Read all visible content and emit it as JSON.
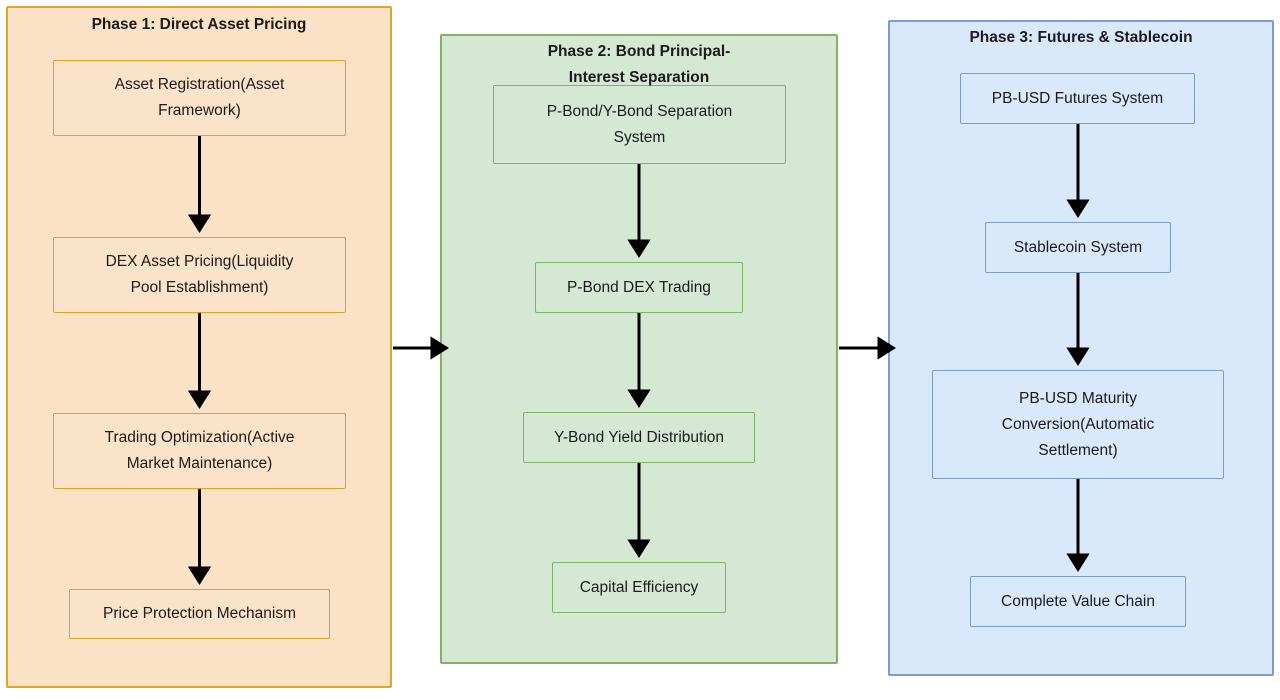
{
  "diagram": {
    "title_visible": false,
    "type": "flowchart",
    "orientation": "left-to-right phases with top-to-bottom steps",
    "colors": {
      "phase1_fill": "#fbe2c6",
      "phase1_stroke": "#e0a524",
      "phase2_fill": "#d5e8d4",
      "phase2_stroke": "#82b366",
      "phase3_fill": "#dae8fc",
      "phase3_stroke": "#7a9ec7",
      "arrow": "#000000",
      "text": "#1b1b1b",
      "background": "#ffffff"
    }
  },
  "phases": [
    {
      "id": "phase1",
      "title": "Phase 1: Direct Asset Pricing",
      "nodes": [
        {
          "id": "p1n1",
          "label": "Asset Registration(Asset\nFramework)"
        },
        {
          "id": "p1n2",
          "label": "DEX Asset Pricing(Liquidity\nPool Establishment)"
        },
        {
          "id": "p1n3",
          "label": "Trading Optimization(Active\nMarket Maintenance)"
        },
        {
          "id": "p1n4",
          "label": "Price Protection Mechanism"
        }
      ]
    },
    {
      "id": "phase2",
      "title": "Phase 2: Bond Principal-\nInterest Separation",
      "nodes": [
        {
          "id": "p2n1",
          "label": "P-Bond/Y-Bond Separation\nSystem"
        },
        {
          "id": "p2n2",
          "label": "P-Bond DEX Trading"
        },
        {
          "id": "p2n3",
          "label": "Y-Bond Yield Distribution"
        },
        {
          "id": "p2n4",
          "label": "Capital Efficiency"
        }
      ]
    },
    {
      "id": "phase3",
      "title": "Phase 3: Futures & Stablecoin",
      "nodes": [
        {
          "id": "p3n1",
          "label": "PB-USD Futures System"
        },
        {
          "id": "p3n2",
          "label": "Stablecoin System"
        },
        {
          "id": "p3n3",
          "label": "PB-USD Maturity\nConversion(Automatic\nSettlement)"
        },
        {
          "id": "p3n4",
          "label": "Complete Value Chain"
        }
      ]
    }
  ],
  "connections": [
    {
      "from": "p1n1",
      "to": "p1n2",
      "direction": "down"
    },
    {
      "from": "p1n2",
      "to": "p1n3",
      "direction": "down"
    },
    {
      "from": "p1n3",
      "to": "p1n4",
      "direction": "down"
    },
    {
      "from": "p2n1",
      "to": "p2n2",
      "direction": "down"
    },
    {
      "from": "p2n2",
      "to": "p2n3",
      "direction": "down"
    },
    {
      "from": "p2n3",
      "to": "p2n4",
      "direction": "down"
    },
    {
      "from": "p3n1",
      "to": "p3n2",
      "direction": "down"
    },
    {
      "from": "p3n2",
      "to": "p3n3",
      "direction": "down"
    },
    {
      "from": "p3n3",
      "to": "p3n4",
      "direction": "down"
    },
    {
      "from": "phase1",
      "to": "phase2",
      "direction": "right"
    },
    {
      "from": "phase2",
      "to": "phase3",
      "direction": "right"
    }
  ]
}
